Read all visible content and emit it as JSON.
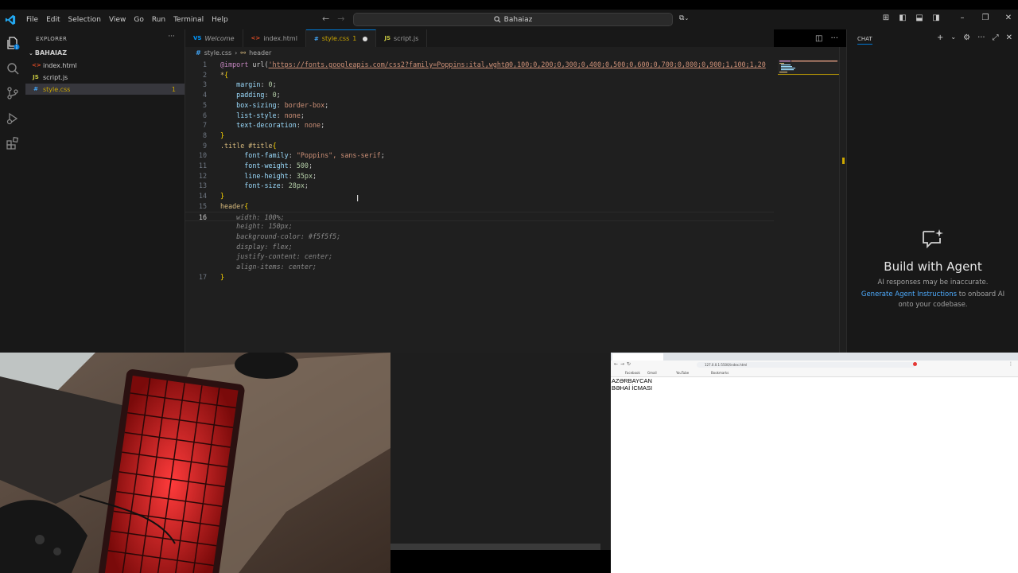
{
  "menu": [
    "File",
    "Edit",
    "Selection",
    "View",
    "Go",
    "Run",
    "Terminal",
    "Help"
  ],
  "command_center": {
    "text": "Bahaiaz"
  },
  "explorer": {
    "title": "EXPLORER",
    "folder": "BAHAIAZ",
    "files": [
      {
        "name": "index.html",
        "icon": "<>",
        "icon_color": "#e44d26",
        "active": false,
        "badge": ""
      },
      {
        "name": "script.js",
        "icon": "JS",
        "icon_color": "#cbcb41",
        "active": false,
        "badge": ""
      },
      {
        "name": "style.css",
        "icon": "#",
        "icon_color": "#42a5f5",
        "active": true,
        "badge": "1"
      }
    ]
  },
  "tabs": [
    {
      "label": "Welcome",
      "icon": "VS",
      "icon_color": "#0098ff",
      "italic": true,
      "modified": "",
      "dirty": false,
      "active": false
    },
    {
      "label": "index.html",
      "icon": "<>",
      "icon_color": "#e44d26",
      "italic": false,
      "modified": "",
      "dirty": false,
      "active": false
    },
    {
      "label": "style.css",
      "icon": "#",
      "icon_color": "#42a5f5",
      "italic": false,
      "modified": "1",
      "dirty": true,
      "active": true
    },
    {
      "label": "script.js",
      "icon": "JS",
      "icon_color": "#cbcb41",
      "italic": false,
      "modified": "",
      "dirty": false,
      "active": false
    }
  ],
  "breadcrumb": {
    "file": "style.css",
    "symbol": "header"
  },
  "code": [
    {
      "ln": "1",
      "tokens": [
        [
          "kw",
          "@import"
        ],
        [
          "punct",
          " "
        ],
        [
          "punct",
          "url("
        ],
        [
          "url",
          "'https://fonts.googleapis.com/css2?family=Poppins:ital,wght@0,100;0,200;0,300;0,400;0,500;0,600;0,700;0,800;0,900;1,100;1,20"
        ]
      ]
    },
    {
      "ln": "2",
      "tokens": [
        [
          "sel",
          "*"
        ],
        [
          "brace",
          "{"
        ]
      ]
    },
    {
      "ln": "3",
      "tokens": [
        [
          "punct",
          "    "
        ],
        [
          "prop",
          "margin"
        ],
        [
          "punct",
          ": "
        ],
        [
          "num",
          "0"
        ],
        [
          "punct",
          ";"
        ]
      ]
    },
    {
      "ln": "4",
      "tokens": [
        [
          "punct",
          "    "
        ],
        [
          "prop",
          "padding"
        ],
        [
          "punct",
          ": "
        ],
        [
          "num",
          "0"
        ],
        [
          "punct",
          ";"
        ]
      ]
    },
    {
      "ln": "5",
      "tokens": [
        [
          "punct",
          "    "
        ],
        [
          "prop",
          "box-sizing"
        ],
        [
          "punct",
          ": "
        ],
        [
          "val",
          "border-box"
        ],
        [
          "punct",
          ";"
        ]
      ]
    },
    {
      "ln": "6",
      "tokens": [
        [
          "punct",
          "    "
        ],
        [
          "prop",
          "list-style"
        ],
        [
          "punct",
          ": "
        ],
        [
          "val",
          "none"
        ],
        [
          "punct",
          ";"
        ]
      ]
    },
    {
      "ln": "7",
      "tokens": [
        [
          "punct",
          "    "
        ],
        [
          "prop",
          "text-decoration"
        ],
        [
          "punct",
          ": "
        ],
        [
          "val",
          "none"
        ],
        [
          "punct",
          ";"
        ]
      ]
    },
    {
      "ln": "8",
      "tokens": [
        [
          "brace",
          "}"
        ]
      ]
    },
    {
      "ln": "9",
      "tokens": [
        [
          "sel",
          ".title #title"
        ],
        [
          "brace",
          "{"
        ]
      ]
    },
    {
      "ln": "10",
      "tokens": [
        [
          "punct",
          "      "
        ],
        [
          "prop",
          "font-family"
        ],
        [
          "punct",
          ": "
        ],
        [
          "val",
          "\"Poppins\", sans-serif"
        ],
        [
          "punct",
          ";"
        ]
      ]
    },
    {
      "ln": "11",
      "tokens": [
        [
          "punct",
          "      "
        ],
        [
          "prop",
          "font-weight"
        ],
        [
          "punct",
          ": "
        ],
        [
          "num",
          "500"
        ],
        [
          "punct",
          ";"
        ]
      ]
    },
    {
      "ln": "12",
      "tokens": [
        [
          "punct",
          "      "
        ],
        [
          "prop",
          "line-height"
        ],
        [
          "punct",
          ": "
        ],
        [
          "num",
          "35px"
        ],
        [
          "punct",
          ";"
        ]
      ]
    },
    {
      "ln": "13",
      "tokens": [
        [
          "punct",
          "      "
        ],
        [
          "prop",
          "font-size"
        ],
        [
          "punct",
          ": "
        ],
        [
          "num",
          "28px"
        ],
        [
          "punct",
          ";"
        ]
      ]
    },
    {
      "ln": "14",
      "tokens": [
        [
          "brace",
          "}"
        ]
      ]
    },
    {
      "ln": "15",
      "tokens": [
        [
          "sel",
          "header"
        ],
        [
          "brace",
          "{"
        ]
      ]
    },
    {
      "ln": "16",
      "current": true,
      "tokens": [
        [
          "punct",
          "    "
        ],
        [
          "ghost",
          "width: 100%;"
        ]
      ]
    },
    {
      "ln": "",
      "tokens": [
        [
          "punct",
          "    "
        ],
        [
          "ghost",
          "height: 150px;"
        ]
      ]
    },
    {
      "ln": "",
      "tokens": [
        [
          "punct",
          "    "
        ],
        [
          "ghost",
          "background-color: #f5f5f5;"
        ]
      ]
    },
    {
      "ln": "",
      "tokens": [
        [
          "punct",
          "    "
        ],
        [
          "ghost",
          "display: flex;"
        ]
      ]
    },
    {
      "ln": "",
      "tokens": [
        [
          "punct",
          "    "
        ],
        [
          "ghost",
          "justify-content: center;"
        ]
      ]
    },
    {
      "ln": "",
      "tokens": [
        [
          "punct",
          "    "
        ],
        [
          "ghost",
          "align-items: center;"
        ]
      ]
    },
    {
      "ln": "17",
      "tokens": [
        [
          "brace",
          "}"
        ]
      ]
    }
  ],
  "chat": {
    "title": "CHAT",
    "heading": "Build with Agent",
    "disclaimer": "AI responses may be inaccurate.",
    "link": "Generate Agent Instructions",
    "desc_rest": " to onboard AI onto your codebase."
  },
  "browser": {
    "address": "127.0.0.1:5500/index.html",
    "bookmarks": [
      "Facebook",
      "Gmail",
      "YouTube",
      "Bookmarks"
    ],
    "page_lines": [
      "AZƏRBAYCAN",
      "BƏHAİ İCMASI"
    ]
  }
}
